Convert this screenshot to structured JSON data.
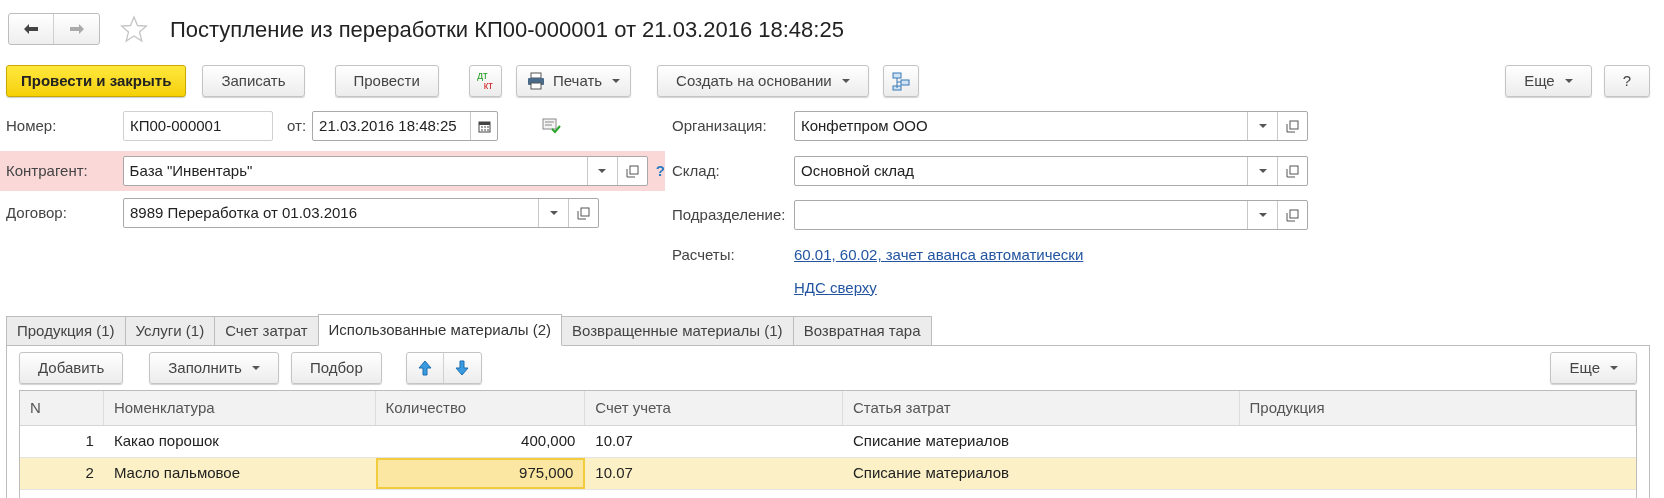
{
  "title": "Поступление из переработки КП00-000001 от 21.03.2016 18:48:25",
  "toolbar": [
    {
      "kind": "primary",
      "label": "Провести и закрыть"
    },
    {
      "kind": "button",
      "label": "Записать"
    },
    {
      "kind": "button",
      "label": "Провести"
    },
    {
      "kind": "dtkt",
      "top": "дт",
      "bottom": "кт"
    },
    {
      "kind": "print",
      "label": "Печать"
    },
    {
      "kind": "menu",
      "label": "Создать на основании"
    },
    {
      "kind": "structure"
    }
  ],
  "toolbar_right": [
    {
      "kind": "menu",
      "label": "Еще"
    },
    {
      "kind": "button",
      "label": "?"
    }
  ],
  "number": {
    "label": "Номер:",
    "value": "КП00-000001"
  },
  "date": {
    "label": "от:",
    "value": "21.03.2016 18:48:25"
  },
  "counterparty": {
    "label": "Контрагент:",
    "value": "База \"Инвентарь\"",
    "error": true,
    "hint": "?"
  },
  "contract": {
    "label": "Договор:",
    "value": "8989 Переработка от 01.03.2016"
  },
  "organization": {
    "label": "Организация:",
    "value": "Конфетпром ООО"
  },
  "warehouse": {
    "label": "Склад:",
    "value": "Основной склад"
  },
  "division": {
    "label": "Подразделение:"
  },
  "settlements": {
    "label": "Расчеты:",
    "link": "60.01, 60.02, зачет аванса автоматически"
  },
  "vat_link": "НДС сверху",
  "tabs": [
    {
      "label": "Продукция (1)",
      "selected": false
    },
    {
      "label": "Услуги (1)",
      "selected": false
    },
    {
      "label": "Счет затрат",
      "selected": false
    },
    {
      "label": "Использованные материалы (2)",
      "selected": true
    },
    {
      "label": "Возвращенные материалы (1)",
      "selected": false
    },
    {
      "label": "Возвратная тара",
      "selected": false
    }
  ],
  "table_toolbar": [
    {
      "kind": "button",
      "label": "Добавить"
    },
    {
      "kind": "menu",
      "label": "Заполнить"
    },
    {
      "kind": "button",
      "label": "Подбор"
    },
    {
      "kind": "arrows"
    }
  ],
  "table_toolbar_right": [
    {
      "kind": "menu",
      "label": "Еще"
    }
  ],
  "table": {
    "columns": [
      "N",
      "Номенклатура",
      "Количество",
      "Счет учета",
      "Статья затрат",
      "Продукция"
    ],
    "rows": [
      {
        "selected": false,
        "cells": [
          {
            "text": "1",
            "focused": false
          },
          {
            "text": "Какао порошок",
            "focused": false
          },
          {
            "text": "400,000",
            "focused": false
          },
          {
            "text": "10.07",
            "focused": false
          },
          {
            "text": "Списание материалов",
            "focused": false
          }
        ]
      },
      {
        "selected": true,
        "cells": [
          {
            "text": "2",
            "focused": false
          },
          {
            "text": "Масло пальмовое",
            "focused": false
          },
          {
            "text": "975,000",
            "focused": true
          },
          {
            "text": "10.07",
            "focused": false
          },
          {
            "text": "Списание материалов",
            "focused": false
          }
        ]
      }
    ]
  }
}
